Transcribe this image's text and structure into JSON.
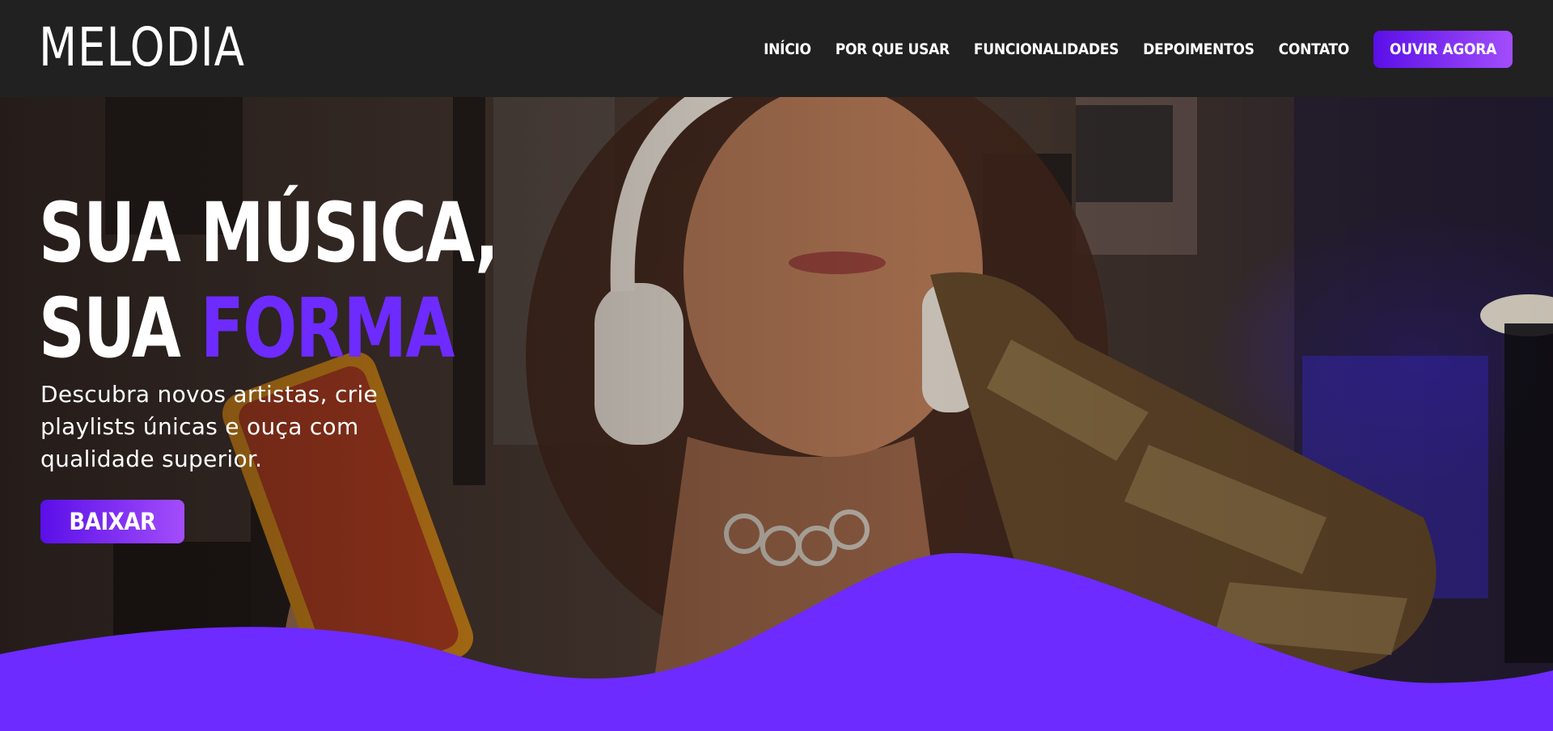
{
  "brand": {
    "logo_text": "MELODIA"
  },
  "nav": {
    "items": [
      {
        "label": "INÍCIO"
      },
      {
        "label": "POR QUE USAR"
      },
      {
        "label": "FUNCIONALIDADES"
      },
      {
        "label": "DEPOIMENTOS"
      },
      {
        "label": "CONTATO"
      }
    ],
    "cta_label": "OUVIR AGORA"
  },
  "hero": {
    "title_line1": "SUA MÚSICA,",
    "title_line2_prefix": "SUA ",
    "title_line2_accent": "FORMA",
    "subtitle": "Descubra novos artistas, crie playlists únicas e ouça com qualidade superior.",
    "button_label": "BAIXAR"
  },
  "colors": {
    "header_bg": "#212121",
    "accent": "#6d2bff",
    "gradient_start": "#5a0fe8",
    "gradient_end": "#a34dfb",
    "wave": "#6d2bff"
  },
  "icons": {
    "photo": "person-with-headphones-photo"
  }
}
